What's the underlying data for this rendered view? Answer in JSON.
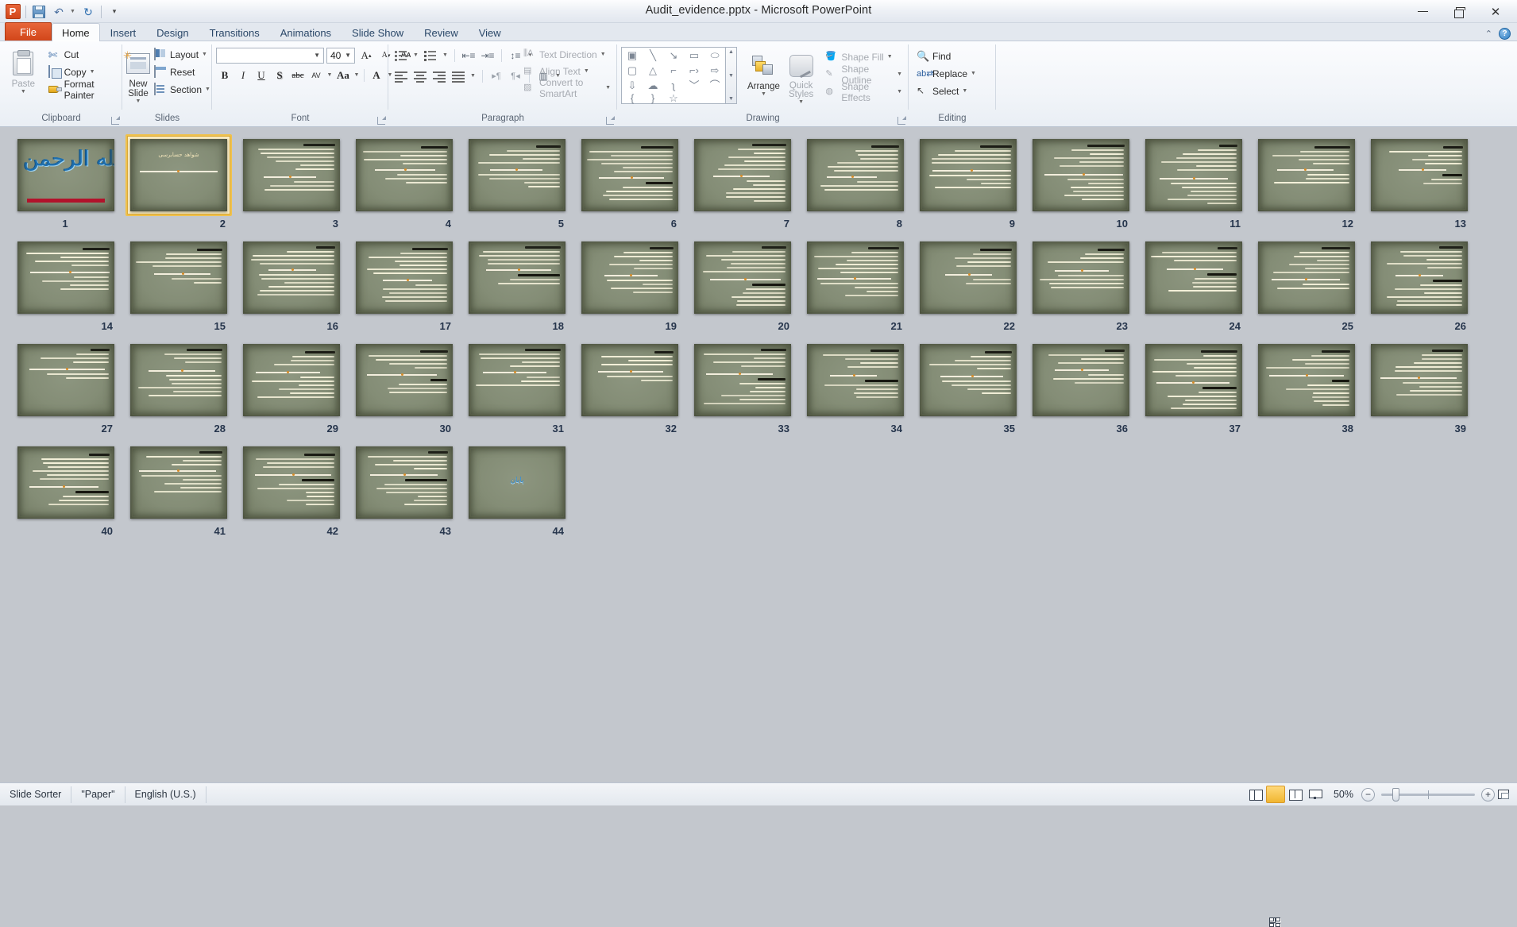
{
  "window": {
    "title": "Audit_evidence.pptx  -  Microsoft PowerPoint",
    "app_logo": "powerpoint-logo",
    "minimize": "—",
    "restore": "restore-icon",
    "close": "✕"
  },
  "quick_access": {
    "save": "Save",
    "undo": "Undo",
    "redo": "Redo",
    "customize": "Customize Quick Access Toolbar"
  },
  "tabs": [
    {
      "label": "File",
      "kind": "file"
    },
    {
      "label": "Home",
      "kind": "active"
    },
    {
      "label": "Insert",
      "kind": "normal"
    },
    {
      "label": "Design",
      "kind": "normal"
    },
    {
      "label": "Transitions",
      "kind": "normal"
    },
    {
      "label": "Animations",
      "kind": "normal"
    },
    {
      "label": "Slide Show",
      "kind": "normal"
    },
    {
      "label": "Review",
      "kind": "normal"
    },
    {
      "label": "View",
      "kind": "normal"
    }
  ],
  "ribbon": {
    "help_button": "?",
    "minimize_ribbon": "⌃",
    "groups": {
      "clipboard": {
        "label": "Clipboard",
        "paste": "Paste",
        "cut": "Cut",
        "copy": "Copy",
        "format_painter": "Format Painter"
      },
      "slides": {
        "label": "Slides",
        "new_slide": "New Slide",
        "layout": "Layout",
        "reset": "Reset",
        "section": "Section"
      },
      "font": {
        "label": "Font",
        "font_name": "",
        "font_size": "40",
        "grow": "Increase Font Size",
        "shrink": "Decrease Font Size",
        "clear_formatting": "Clear All Formatting",
        "bold": "B",
        "italic": "I",
        "underline": "U",
        "shadow": "S",
        "strikethrough": "abc",
        "spacing": "AV",
        "change_case": "Aa",
        "font_color": "A"
      },
      "paragraph": {
        "label": "Paragraph",
        "bullets": "Bullets",
        "numbering": "Numbering",
        "decrease_indent": "Decrease List Level",
        "increase_indent": "Increase List Level",
        "line_spacing": "Line Spacing",
        "text_direction": "Text Direction",
        "align_text": "Align Text",
        "convert_to_smartart": "Convert to SmartArt",
        "align_left": "Align Text Left",
        "center": "Center",
        "align_right": "Align Text Right",
        "justify": "Justify",
        "ltr": "Left-to-Right",
        "rtl": "Right-to-Left",
        "columns": "Columns"
      },
      "drawing": {
        "label": "Drawing",
        "shapes": [
          "textbox",
          "line",
          "arrow",
          "rectangle",
          "oval",
          "rounded-rect",
          "triangle",
          "elbow-connector",
          "elbow-arrow",
          "right-arrow",
          "down-arrow",
          "cloud",
          "freeform",
          "curve",
          "arc",
          "left-brace",
          "right-brace",
          "star"
        ],
        "arrange": "Arrange",
        "quick_styles": "Quick Styles",
        "shape_fill": "Shape Fill",
        "shape_outline": "Shape Outline",
        "shape_effects": "Shape Effects"
      },
      "editing": {
        "label": "Editing",
        "find": "Find",
        "replace": "Replace",
        "select": "Select"
      }
    }
  },
  "slide_sorter": {
    "selected_slide": 2,
    "slides": [
      {
        "n": 1,
        "kind": "title-bismillah",
        "title": "بسم الله الرحمن الرحيم"
      },
      {
        "n": 2,
        "kind": "section-title",
        "title": "شواهد حسابرسی"
      },
      {
        "n": 3,
        "kind": "text"
      },
      {
        "n": 4,
        "kind": "text"
      },
      {
        "n": 5,
        "kind": "text"
      },
      {
        "n": 6,
        "kind": "text"
      },
      {
        "n": 7,
        "kind": "text"
      },
      {
        "n": 8,
        "kind": "text"
      },
      {
        "n": 9,
        "kind": "text"
      },
      {
        "n": 10,
        "kind": "text"
      },
      {
        "n": 11,
        "kind": "text"
      },
      {
        "n": 12,
        "kind": "text"
      },
      {
        "n": 13,
        "kind": "text"
      },
      {
        "n": 14,
        "kind": "text"
      },
      {
        "n": 15,
        "kind": "text"
      },
      {
        "n": 16,
        "kind": "text"
      },
      {
        "n": 17,
        "kind": "text"
      },
      {
        "n": 18,
        "kind": "text"
      },
      {
        "n": 19,
        "kind": "text"
      },
      {
        "n": 20,
        "kind": "text"
      },
      {
        "n": 21,
        "kind": "text"
      },
      {
        "n": 22,
        "kind": "text"
      },
      {
        "n": 23,
        "kind": "text"
      },
      {
        "n": 24,
        "kind": "text"
      },
      {
        "n": 25,
        "kind": "text"
      },
      {
        "n": 26,
        "kind": "text"
      },
      {
        "n": 27,
        "kind": "text"
      },
      {
        "n": 28,
        "kind": "text"
      },
      {
        "n": 29,
        "kind": "text"
      },
      {
        "n": 30,
        "kind": "text"
      },
      {
        "n": 31,
        "kind": "text"
      },
      {
        "n": 32,
        "kind": "text"
      },
      {
        "n": 33,
        "kind": "text"
      },
      {
        "n": 34,
        "kind": "text"
      },
      {
        "n": 35,
        "kind": "text"
      },
      {
        "n": 36,
        "kind": "text"
      },
      {
        "n": 37,
        "kind": "text"
      },
      {
        "n": 38,
        "kind": "text"
      },
      {
        "n": 39,
        "kind": "text"
      },
      {
        "n": 40,
        "kind": "text"
      },
      {
        "n": 41,
        "kind": "text"
      },
      {
        "n": 42,
        "kind": "text"
      },
      {
        "n": 43,
        "kind": "text"
      },
      {
        "n": 44,
        "kind": "end",
        "title": "پایان"
      }
    ]
  },
  "status_bar": {
    "view_name": "Slide Sorter",
    "theme": "\"Paper\"",
    "language": "English (U.S.)",
    "zoom_level": "50%",
    "zoom_out": "−",
    "zoom_in": "+",
    "views": [
      {
        "name": "normal",
        "label": "Normal",
        "active": false
      },
      {
        "name": "sorter",
        "label": "Slide Sorter",
        "active": true
      },
      {
        "name": "read",
        "label": "Reading View",
        "active": false
      },
      {
        "name": "show",
        "label": "Slide Show",
        "active": false
      }
    ],
    "fit_to_window": "Fit slide to current window"
  },
  "colors": {
    "accent_orange": "#d2461a",
    "selection_gold": "#f0c14b",
    "slide_bg": "#868f79",
    "slide_text": "#fdf8e1",
    "bismillah_blue": "#1f6fae",
    "red_bar": "#b4132c",
    "dot_orange": "#d88c27",
    "window_bg": "#c3c7cd"
  }
}
